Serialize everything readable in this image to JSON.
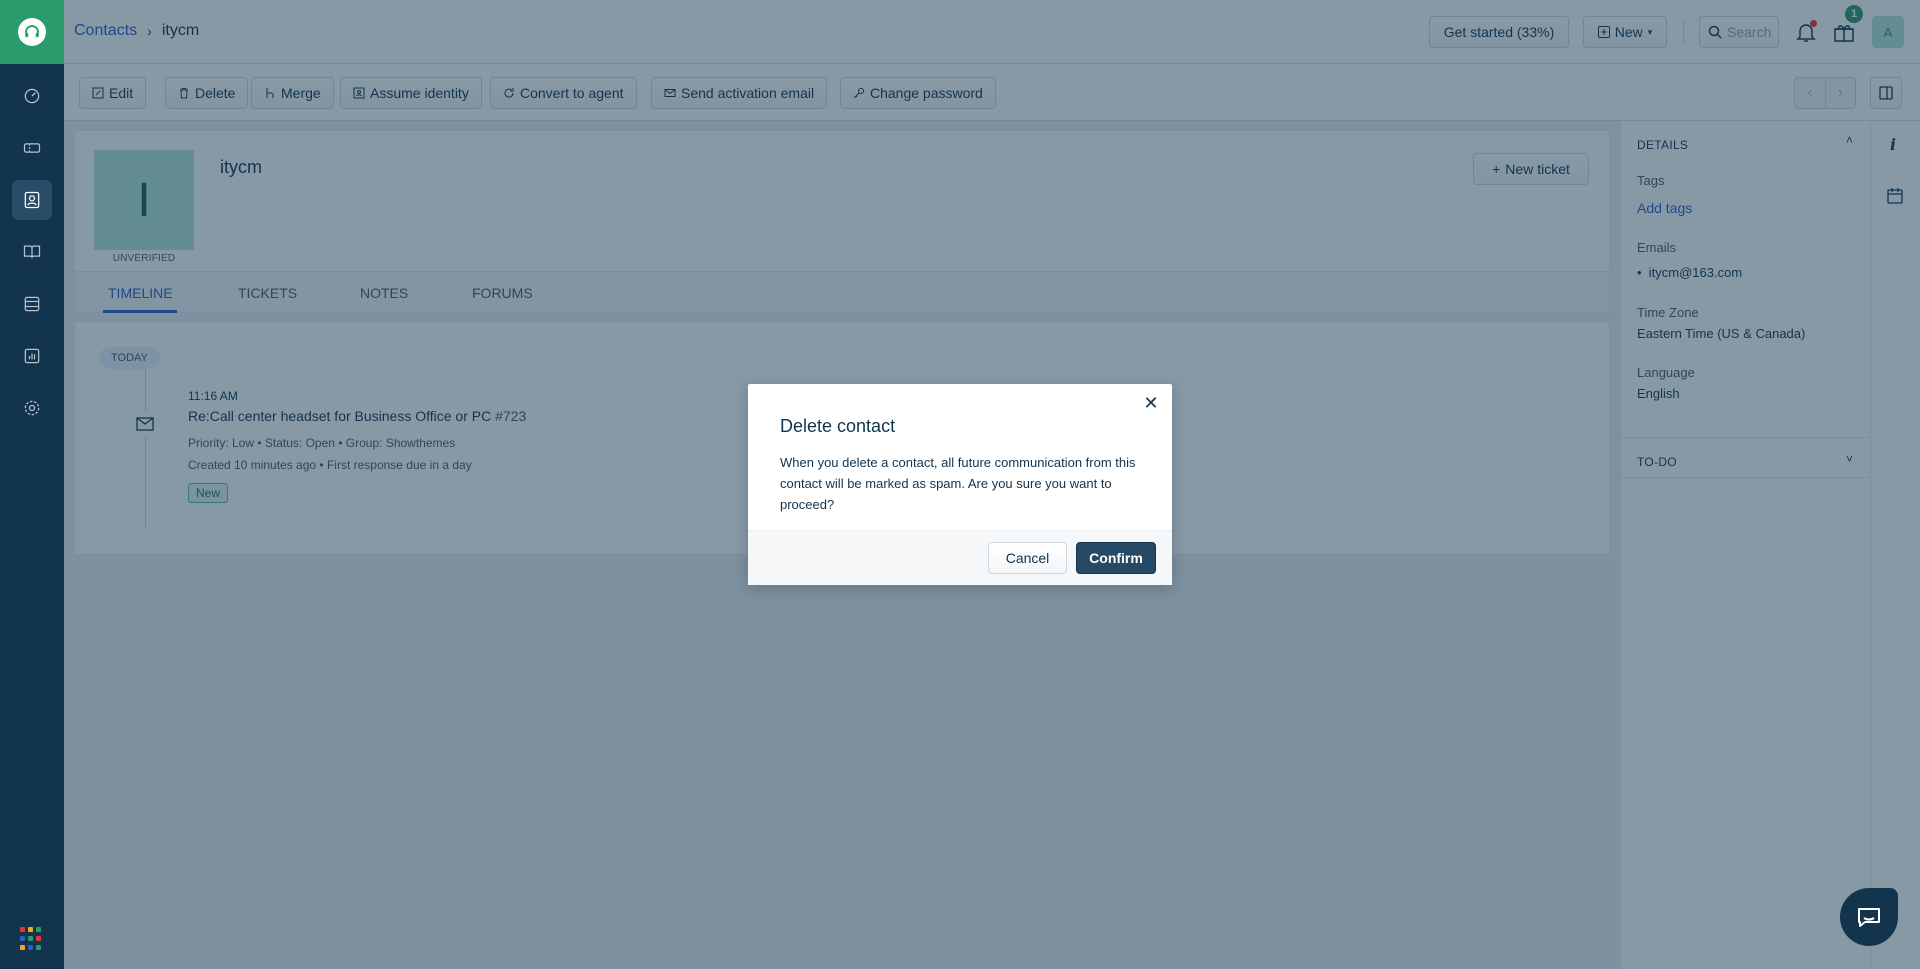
{
  "header": {
    "breadcrumb_root": "Contacts",
    "breadcrumb_current": "itycm",
    "get_started": "Get started (33%)",
    "new_label": "New",
    "search_label": "Search",
    "gift_badge": "1",
    "avatar_initial": "A"
  },
  "toolbar": {
    "edit": "Edit",
    "delete": "Delete",
    "merge": "Merge",
    "assume_identity": "Assume identity",
    "convert_to_agent": "Convert to agent",
    "send_activation": "Send activation email",
    "change_password": "Change password"
  },
  "profile": {
    "initial": "I",
    "status": "UNVERIFIED",
    "name": "itycm",
    "new_ticket": "New ticket"
  },
  "tabs": [
    "TIMELINE",
    "TICKETS",
    "NOTES",
    "FORUMS"
  ],
  "timeline": {
    "day": "TODAY",
    "time": "11:16 AM",
    "title": "Re:Call center headset for Business Office or PC",
    "number": "#723",
    "meta1": "Priority: Low  •  Status: Open  •  Group: Showthemes",
    "meta2": "Created 10 minutes ago  •  First response due in a day",
    "status": "New"
  },
  "details": {
    "heading": "DETAILS",
    "tags_label": "Tags",
    "add_tags": "Add tags",
    "emails_label": "Emails",
    "email": "itycm@163.com",
    "timezone_label": "Time Zone",
    "timezone": "Eastern Time (US & Canada)",
    "language_label": "Language",
    "language": "English",
    "todo": "TO-DO"
  },
  "modal": {
    "title": "Delete contact",
    "body": "When you delete a contact, all future communication from this contact will be marked as spam. Are you sure you want to proceed?",
    "cancel": "Cancel",
    "confirm": "Confirm"
  },
  "colors": {
    "sidebar": "#12344d",
    "brand": "#2c9b6b",
    "link": "#2c5cc5",
    "confirm": "#264966"
  }
}
